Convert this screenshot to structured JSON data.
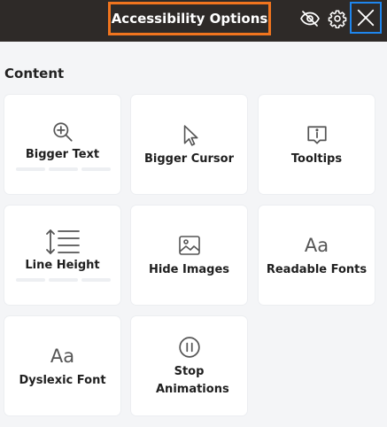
{
  "header": {
    "title": "Accessibility Options",
    "icons": [
      "eye-slash-icon",
      "gear-icon",
      "close-icon"
    ]
  },
  "section": {
    "title": "Content"
  },
  "cards": [
    {
      "label": "Bigger Text",
      "icon": "zoom-in-icon"
    },
    {
      "label": "Bigger Cursor",
      "icon": "cursor-icon"
    },
    {
      "label": "Tooltips",
      "icon": "tooltip-icon"
    },
    {
      "label": "Line Height",
      "icon": "line-height-icon"
    },
    {
      "label": "Hide Images",
      "icon": "image-icon"
    },
    {
      "label": "Readable Fonts",
      "icon": "font-icon",
      "glyph": "Aa"
    },
    {
      "label": "Dyslexic Font",
      "icon": "font-icon",
      "glyph": "Aa"
    },
    {
      "label": "Stop Animations",
      "icon": "pause-icon"
    }
  ],
  "colors": {
    "header_bg": "#2e2a28",
    "title_highlight": "#f0741e",
    "close_highlight": "#1f86ee"
  }
}
